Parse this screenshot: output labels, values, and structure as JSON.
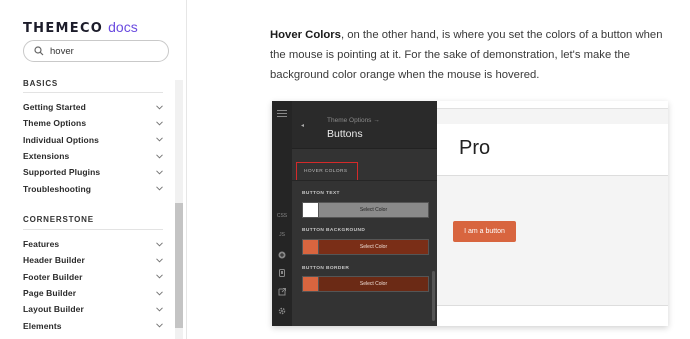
{
  "sidebar": {
    "logo_brand": "THEMECO",
    "logo_docs": "docs",
    "search": {
      "value": "hover",
      "placeholder": "Search"
    },
    "sections": [
      {
        "title": "BASICS",
        "items": [
          "Getting Started",
          "Theme Options",
          "Individual Options",
          "Extensions",
          "Supported Plugins",
          "Troubleshooting"
        ]
      },
      {
        "title": "CORNERSTONE",
        "items": [
          "Features",
          "Header Builder",
          "Footer Builder",
          "Page Builder",
          "Layout Builder",
          "Elements"
        ]
      }
    ]
  },
  "main": {
    "paragraph_bold": "Hover Colors",
    "paragraph_rest": ", on the other hand, is where you set the colors of a button when the mouse is pointing at it. For the sake of demonstration, let's make the background color orange when the mouse is hovered."
  },
  "screenshot": {
    "rail": {
      "css_label": "CSS",
      "js_label": "JS"
    },
    "panel": {
      "breadcrumb": "Theme Options →",
      "title": "Buttons",
      "tab": "HOVER COLORS",
      "controls": [
        {
          "label": "BUTTON TEXT",
          "button": "Select Color",
          "swatch": "#ffffff",
          "bar": "#8a8a8a",
          "text_color": "#222222"
        },
        {
          "label": "BUTTON BACKGROUND",
          "button": "Select Color",
          "swatch": "#d8653f",
          "bar": "#7a2e17",
          "text_color": "#f0e0d8"
        },
        {
          "label": "BUTTON BORDER",
          "button": "Select Color",
          "swatch": "#d8653f",
          "bar": "#6b2a15",
          "text_color": "#f0e0d8"
        }
      ]
    },
    "preview": {
      "title": "Pro",
      "button_label": "I am a button",
      "button_color": "#d8653f"
    }
  },
  "colors": {
    "brand_purple": "#6b4ce0",
    "highlight_red": "#d42a2a",
    "accent_orange": "#d8653f"
  }
}
